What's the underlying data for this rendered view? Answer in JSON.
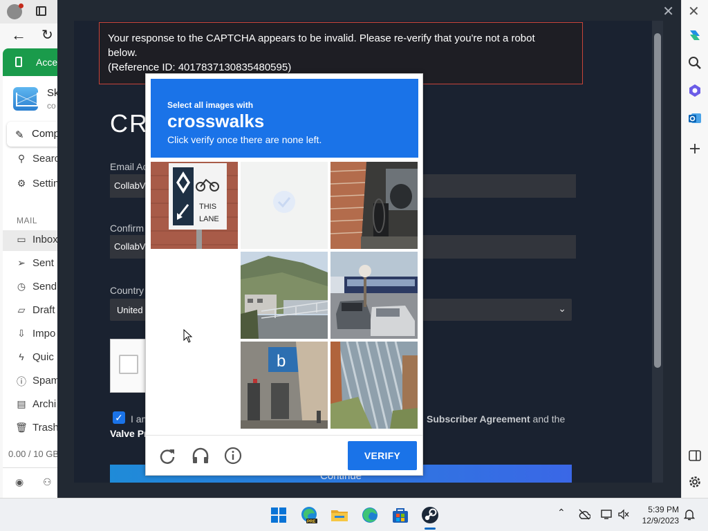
{
  "browser": {
    "account_banner": "Acce",
    "mail_account_name": "Sk",
    "mail_account_sub": "co",
    "compose_label": "Comp",
    "search_label": "Searc",
    "settings_label": "Settin",
    "section_label": "MAIL",
    "folders": [
      {
        "icon": "inbox-icon",
        "label": "Inbox"
      },
      {
        "icon": "send-icon",
        "label": "Sent"
      },
      {
        "icon": "clock-icon",
        "label": "Send"
      },
      {
        "icon": "draft-icon",
        "label": "Draft"
      },
      {
        "icon": "import-icon",
        "label": "Impo"
      },
      {
        "icon": "bolt-icon",
        "label": "Quic"
      },
      {
        "icon": "spam-icon",
        "label": "Spam"
      },
      {
        "icon": "archive-icon",
        "label": "Archi"
      },
      {
        "icon": "trash-icon",
        "label": "Trash"
      }
    ],
    "storage": "0.00 / 10 GB"
  },
  "steam": {
    "error_line1": "Your response to the CAPTCHA appears to be invalid. Please re-verify that you're not a robot",
    "error_line2": "below.",
    "error_line3": "(Reference ID: 4017837130835480595)",
    "title": "CRE",
    "email_label": "Email Ac",
    "email_value": "CollabV",
    "confirm_label": "Confirm",
    "confirm_value": "CollabV",
    "country_label": "Country",
    "country_value": "United",
    "agree_prefix": "I am",
    "agree_link1": "Subscriber Agreement",
    "agree_and": "and the",
    "agree_line2": "Valve Pr",
    "continue_label": "Continue"
  },
  "captcha": {
    "instruction_small": "Select all images with",
    "target_word": "crosswalks",
    "instruction_sub": "Click verify once there are none left.",
    "verify_label": "VERIFY",
    "tiles": [
      "sign-bike-lane",
      "fading-selected",
      "brick-wall-bike",
      "blank",
      "hills-fence",
      "bus-cars",
      "blank",
      "building-door",
      "corrugated-wall"
    ],
    "footer_icons": [
      "reload-icon",
      "audio-icon",
      "info-icon"
    ]
  },
  "taskbar": {
    "time": "5:39 PM",
    "date": "12/9/2023",
    "apps": [
      "windows-start-icon",
      "edge-preview-icon",
      "file-explorer-icon",
      "edge-icon",
      "store-icon",
      "steam-icon"
    ]
  },
  "colors": {
    "captcha_blue": "#1a73e8",
    "error_border": "#c8443a",
    "steam_bg": "#1a2230",
    "banner_green": "#1a9b4b"
  }
}
